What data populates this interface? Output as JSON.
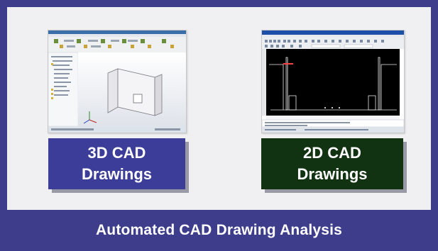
{
  "cards": {
    "card_3d": {
      "line1": "3D CAD",
      "line2": "Drawings"
    },
    "card_2d": {
      "line1": "2D CAD",
      "line2": "Drawings"
    }
  },
  "banner": {
    "title": "Automated CAD Drawing Analysis"
  },
  "colors": {
    "frame": "#3d3d8c",
    "card_3d": "#3c3c99",
    "card_2d": "#113311",
    "background": "#f0f0f2"
  }
}
